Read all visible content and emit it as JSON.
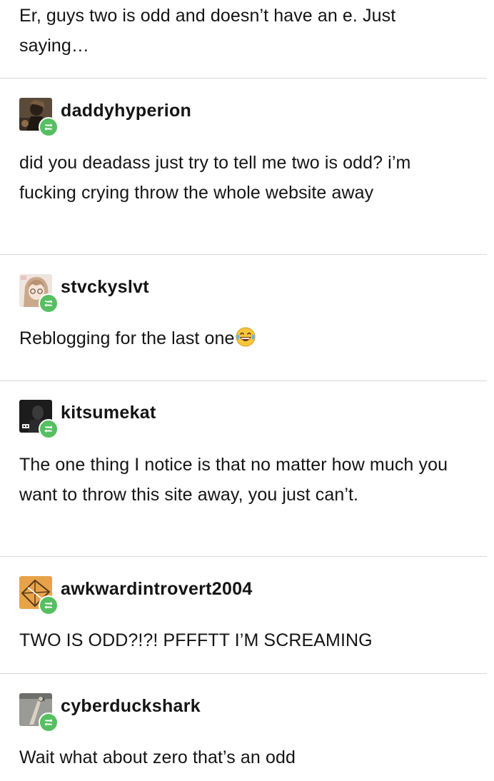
{
  "posts": [
    {
      "text": "Er, guys two is odd and doesn’t have an e. Just saying…"
    },
    {
      "username": "daddyhyperion",
      "avatar_icon": "dark-figure-avatar",
      "text": "did you deadass just try to tell me two is odd? i’m fucking crying throw the whole website away"
    },
    {
      "username": "stvckyslvt",
      "avatar_icon": "anime-girl-avatar",
      "text": "Reblogging for the last one",
      "emoji": "face-with-tears-of-joy"
    },
    {
      "username": "kitsumekat",
      "avatar_icon": "dark-portrait-avatar",
      "text": "The one thing I notice is that no matter how much you want to throw this site away, you just can’t."
    },
    {
      "username": "awkwardintrovert2004",
      "avatar_icon": "geometric-orange-avatar",
      "text": "TWO IS ODD?!?! PFFFTT I’M SCREAMING"
    },
    {
      "username": "cyberduckshark",
      "avatar_icon": "grey-figure-avatar",
      "text": "Wait what about zero that’s an odd"
    }
  ],
  "colors": {
    "reblog_badge": "#56bf61",
    "divider": "#d9d9d9",
    "text": "#141414"
  }
}
